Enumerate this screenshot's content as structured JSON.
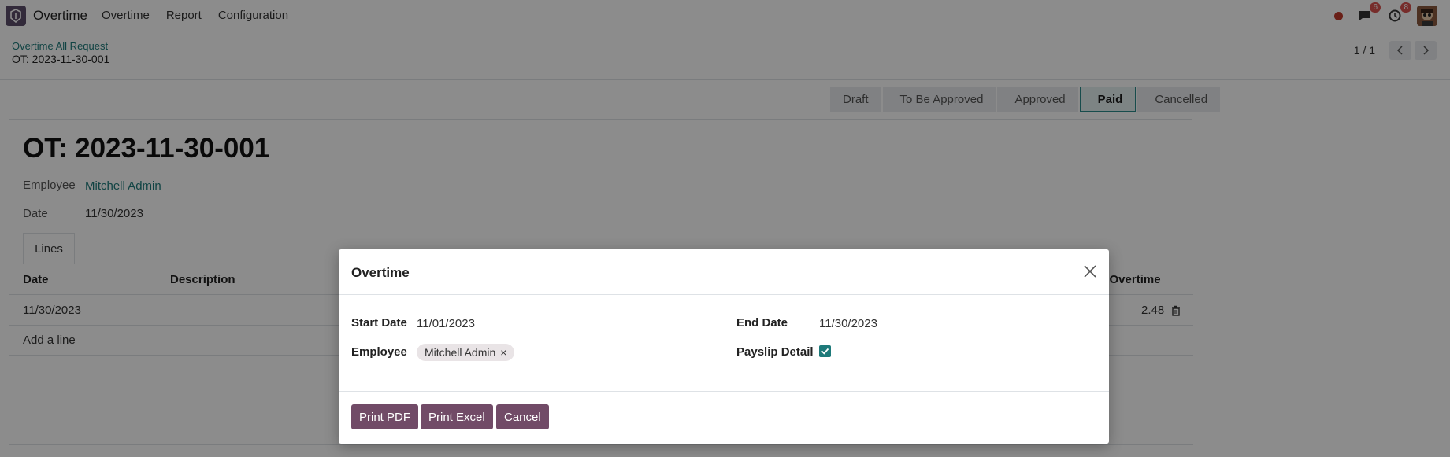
{
  "navbar": {
    "app_name": "Overtime",
    "menu": [
      "Overtime",
      "Report",
      "Configuration"
    ],
    "messages_badge": "6",
    "activities_badge": "8"
  },
  "breadcrumb": {
    "parent": "Overtime All Request",
    "current": "OT: 2023-11-30-001"
  },
  "pager": {
    "value": "1 / 1"
  },
  "statusbar": {
    "stages": [
      "Draft",
      "To Be Approved",
      "Approved",
      "Paid",
      "Cancelled"
    ],
    "active": "Paid"
  },
  "record": {
    "title": "OT: 2023-11-30-001",
    "employee_label": "Employee",
    "employee_value": "Mitchell Admin",
    "date_label": "Date",
    "date_value": "11/30/2023",
    "tab_label": "Lines",
    "columns": {
      "date": "Date",
      "description": "Description",
      "overtime": "e Overtime"
    },
    "lines": [
      {
        "date": "11/30/2023",
        "overtime": "2.48"
      }
    ],
    "add_line": "Add a line"
  },
  "dialog": {
    "title": "Overtime",
    "start_date_label": "Start Date",
    "start_date_value": "11/01/2023",
    "end_date_label": "End Date",
    "end_date_value": "11/30/2023",
    "employee_label": "Employee",
    "employee_tag": "Mitchell Admin",
    "tag_remove": "×",
    "payslip_label": "Payslip Detail",
    "payslip_checked": true,
    "print_pdf": "Print PDF",
    "print_excel": "Print Excel",
    "cancel": "Cancel"
  },
  "colors": {
    "primary": "#714b67",
    "accent": "#1e7a7a"
  }
}
